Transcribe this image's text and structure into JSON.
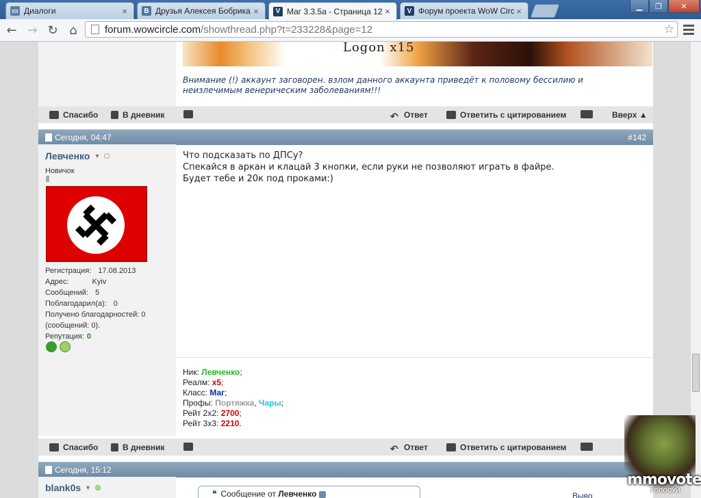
{
  "tabs": [
    {
      "title": "Диалоги",
      "favicon": "vk-messages-icon",
      "color": "#5b7fa6"
    },
    {
      "title": "Друзья Алексея Бобрика",
      "favicon": "vk-icon",
      "color": "#4d76a1",
      "glyph": "В"
    },
    {
      "title": "Маг 3.3.5а - Страница 12",
      "favicon": "forum-v-icon",
      "color": "#1b3e63",
      "glyph": "V"
    },
    {
      "title": "Форум проекта WoW Circ",
      "favicon": "forum-v-icon",
      "color": "#1b3e63",
      "glyph": "V"
    }
  ],
  "address": {
    "host": "forum.wowcircle.com",
    "path": "/showthread.php?t=233228&page=12"
  },
  "top_post": {
    "banner_text": "Logon x15",
    "note": "Внимание (!) аккаунт заговорен. взлом данного аккаунта приведёт к половому бессилию и неизлечимым венерическим заболеваниям!!!"
  },
  "actions": {
    "thanks": "Спасибо",
    "diary": "В дневник",
    "reply": "Ответ",
    "reply_quote": "Ответить с цитированием",
    "top": "Вверх ▲"
  },
  "post142": {
    "date": "Сегодня, 04:47",
    "number": "#142",
    "username": "Левченко",
    "usertitle": "Новичок",
    "stats": {
      "reg_label": "Регистрация:",
      "reg_value": "17.08.2013",
      "addr_label": "Адрес:",
      "addr_value": "Kyiv",
      "posts_label": "Сообщений:",
      "posts_value": "5",
      "thanked_label": "Поблагодарил(а):",
      "thanked_value": "0",
      "received_line1": "Получено благодарностей: 0",
      "received_line2": "(сообщений: 0).",
      "rep_label": "Репутация:",
      "rep_value": "0"
    },
    "text": [
      "Что подсказать по ДПСу?",
      "Спекайся в аркан и клацай 3 кнопки, если руки не позволяют играть в файре.",
      "Будет тебе и 20к под проками:)"
    ],
    "signature": {
      "nick_label": "Ник:",
      "nick": "Левченко",
      "realm_label": "Реалм:",
      "realm": "x5",
      "class_label": "Класс:",
      "class": "Маг",
      "profs_label": "Профы:",
      "prof1": "Портяжка",
      "prof2": "Чары",
      "r2_label": "Рейт 2х2:",
      "r2": "2700",
      "r3_label": "Рейт 3х3:",
      "r3": "2210"
    }
  },
  "post143": {
    "date": "Сегодня, 15:12",
    "username": "blank0s",
    "quote_prefix": "Сообщение от",
    "quote_author": "Левченко",
    "side_link": "Выво"
  },
  "overlay": {
    "brand": "mmovote",
    "sub": "ГОЛОСУЙ"
  }
}
